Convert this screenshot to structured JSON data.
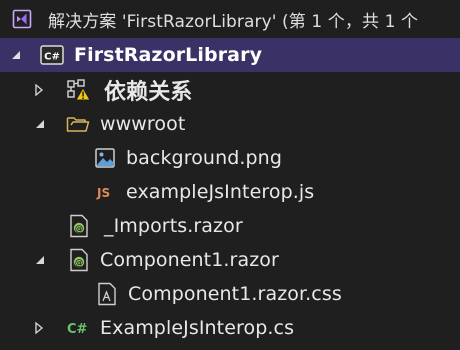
{
  "solution": {
    "label": "解决方案 'FirstRazorLibrary' (第 1 个，共 1 个"
  },
  "project": {
    "label": "FirstRazorLibrary",
    "icon": "csharp-project-icon"
  },
  "items": {
    "dependencies": {
      "label": "依赖关系",
      "icon": "dependencies-warning-icon"
    },
    "wwwroot": {
      "label": "wwwroot",
      "icon": "folder-icon"
    },
    "background": {
      "label": "background.png",
      "icon": "image-file-icon"
    },
    "examplejs": {
      "label": "exampleJsInterop.js",
      "icon": "js-file-icon"
    },
    "imports": {
      "label": "_Imports.razor",
      "icon": "razor-file-icon"
    },
    "component": {
      "label": "Component1.razor",
      "icon": "razor-file-icon"
    },
    "componentcss": {
      "label": "Component1.razor.css",
      "icon": "css-file-icon"
    },
    "examplecs": {
      "label": "ExampleJsInterop.cs",
      "icon": "csharp-file-icon"
    }
  },
  "colors": {
    "background": "#1f1f1f",
    "selection": "#3a3266",
    "razor_green": "#8fc460",
    "js_orange": "#e08a5a",
    "csharp_green": "#6cc36c",
    "folder": "#d9b35a"
  }
}
